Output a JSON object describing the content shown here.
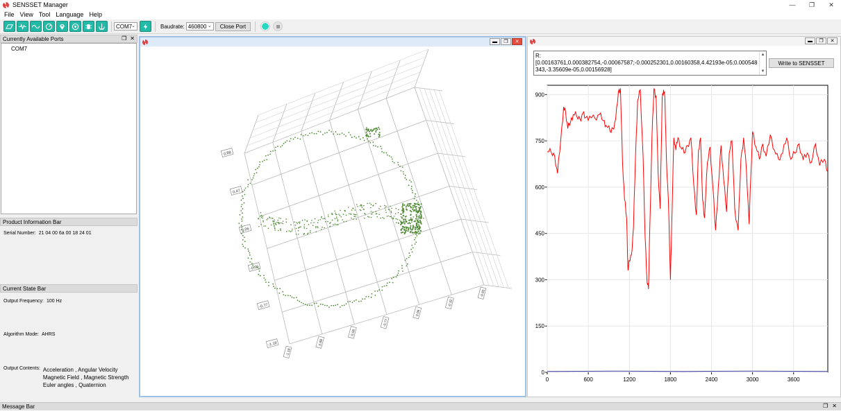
{
  "window": {
    "title": "SENSSET Manager",
    "controls": [
      "minimize-icon",
      "restore-icon",
      "close-icon"
    ]
  },
  "menu": [
    "File",
    "View",
    "Tool",
    "Language",
    "Help"
  ],
  "toolbar": {
    "buttons": [
      "monitor-icon",
      "wave-icon",
      "gyro-icon",
      "gauge-icon",
      "location-icon",
      "magnet-icon",
      "sensor-icon",
      "anchor-icon",
      "flash-icon"
    ],
    "port": "COM7",
    "baudrate_label": "Baudrate:",
    "baudrate": "460800",
    "close_port_label": "Close Port"
  },
  "ports_panel": {
    "title": "Currently Available Ports",
    "items": [
      "COM7"
    ]
  },
  "product_panel": {
    "title": "Product Information Bar",
    "serial_label": "Serial Number:",
    "serial_value": "21 04 00 6a 00 18 24 01"
  },
  "state_panel": {
    "title": "Current State Bar",
    "freq_label": "Output Frequency:",
    "freq_value": "100 Hz",
    "algo_label": "Algorithm Mode:",
    "algo_value": "AHRS",
    "contents_label": "Output Contents:",
    "contents": [
      "Acceleration , Angular Velocity",
      "Magnetic Field , Magnetic Strength",
      "Euler angles , Quaternion"
    ]
  },
  "scene3d": {
    "tick_labels_y": [
      "0.88",
      "0.47",
      "0.06",
      "-0.36",
      "-0.77",
      "-1.18"
    ],
    "tick_labels_z": [
      "-1.18",
      "0.88",
      "0.06",
      "-0.77",
      "0.06",
      "-0.32",
      "-0.65"
    ],
    "colors": {
      "points": "#4f8a34",
      "grid": "#b8b8b8",
      "axis": "#707070"
    }
  },
  "plot_window": {
    "matrix_text": "R:\n[0.00163761,0.000382754,-0.00067587;-0.000252301,0.00160358,4.42193e-05;0.000548343,-3.35609e-05,0.00156928]",
    "write_button": "Write to SENSSET"
  },
  "chart_data": {
    "type": "line",
    "x_ticks": [
      "0",
      "600",
      "1200",
      "1800",
      "2400",
      "3000",
      "3600"
    ],
    "y_ticks": [
      "0",
      "150",
      "300",
      "450",
      "600",
      "750",
      "900"
    ],
    "xlim": [
      0,
      4100
    ],
    "ylim": [
      0,
      930
    ],
    "grid": true,
    "series": [
      {
        "color": "#ff0000",
        "x": [
          0,
          60,
          110,
          150,
          200,
          240,
          270,
          300,
          340,
          380,
          430,
          480,
          520,
          560,
          620,
          700,
          760,
          820,
          860,
          920,
          960,
          1000,
          1040,
          1070,
          1100,
          1130,
          1160,
          1180,
          1200,
          1230,
          1260,
          1290,
          1320,
          1360,
          1400,
          1430,
          1460,
          1480,
          1500,
          1530,
          1560,
          1590,
          1620,
          1650,
          1680,
          1700,
          1720,
          1740,
          1770,
          1800,
          1820,
          1850,
          1880,
          1910,
          1950,
          2000,
          2050,
          2100,
          2140,
          2180,
          2210,
          2240,
          2270,
          2300,
          2340,
          2380,
          2420,
          2460,
          2500,
          2540,
          2580,
          2620,
          2660,
          2700,
          2740,
          2790,
          2830,
          2870,
          2910,
          2950,
          3000,
          3050,
          3100,
          3150,
          3200,
          3260,
          3320,
          3380,
          3440,
          3500,
          3560,
          3620,
          3680,
          3740,
          3800,
          3860,
          3920,
          3980,
          4050,
          4100
        ],
        "y": [
          715,
          712,
          700,
          645,
          760,
          860,
          840,
          790,
          810,
          835,
          830,
          820,
          840,
          825,
          830,
          822,
          835,
          815,
          800,
          780,
          790,
          820,
          910,
          920,
          680,
          560,
          500,
          330,
          360,
          380,
          470,
          700,
          880,
          915,
          700,
          440,
          290,
          270,
          480,
          760,
          920,
          895,
          650,
          530,
          890,
          915,
          885,
          700,
          560,
          300,
          480,
          760,
          720,
          760,
          730,
          710,
          735,
          760,
          610,
          510,
          720,
          760,
          560,
          500,
          680,
          730,
          600,
          460,
          600,
          735,
          620,
          520,
          710,
          750,
          530,
          460,
          690,
          760,
          660,
          480,
          780,
          730,
          690,
          740,
          700,
          770,
          720,
          690,
          710,
          760,
          690,
          710,
          740,
          690,
          710,
          680,
          740,
          670,
          690,
          650
        ]
      },
      {
        "color": "#3a3aa0",
        "x": [
          0,
          1000,
          2000,
          3000,
          4100
        ],
        "y": [
          3,
          4,
          3,
          4,
          3
        ]
      }
    ]
  }
}
